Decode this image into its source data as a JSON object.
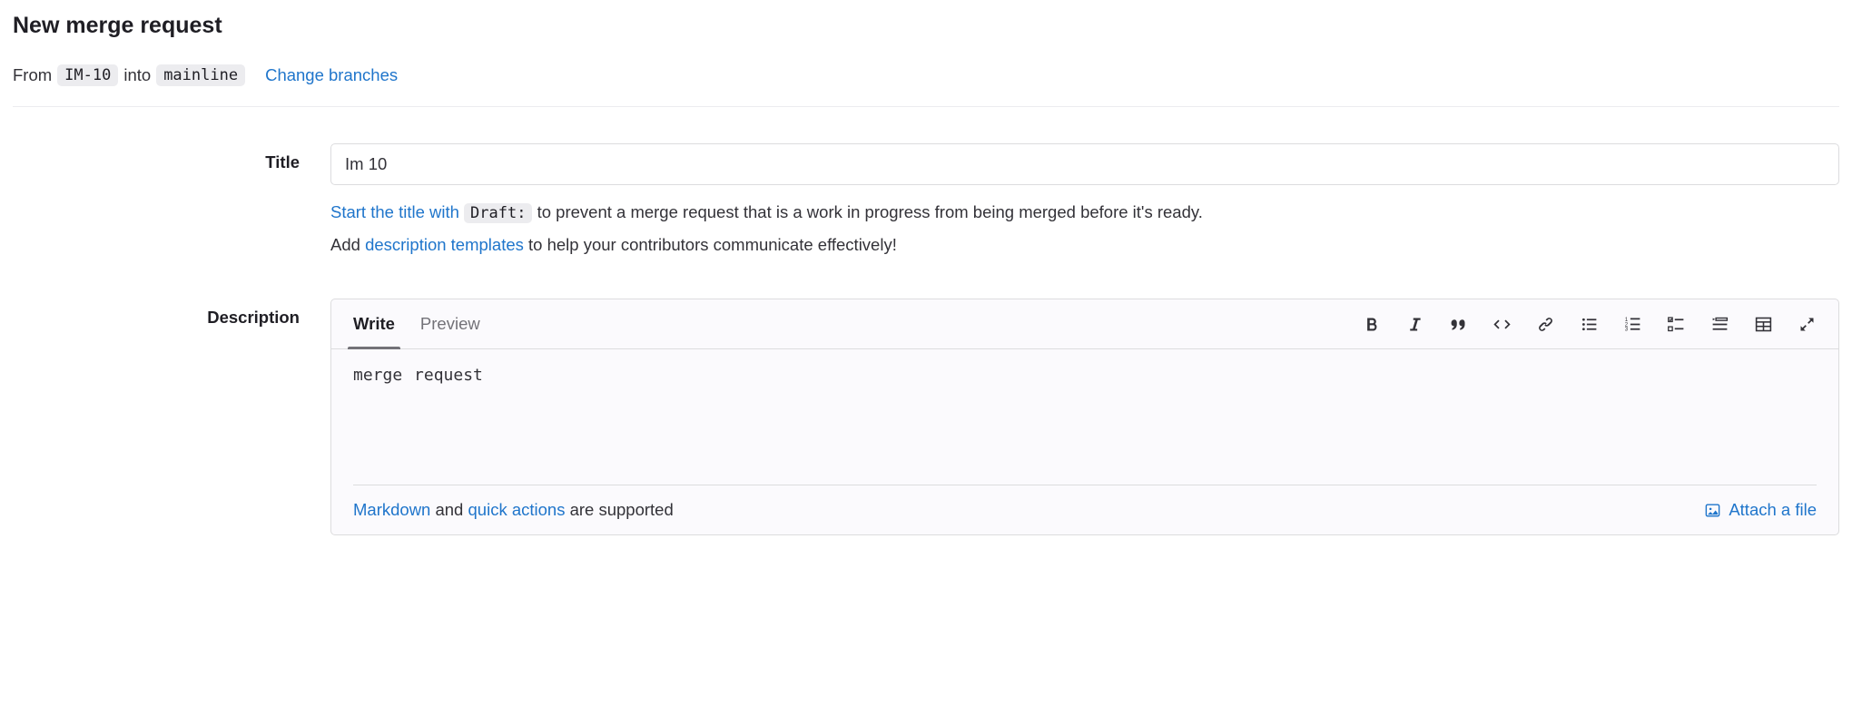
{
  "page_title": "New merge request",
  "branch": {
    "from_label": "From",
    "from_branch": "IM-10",
    "into_label": "into",
    "into_branch": "mainline",
    "change_link": "Change branches"
  },
  "title_section": {
    "label": "Title",
    "value": "Im 10",
    "draft_link_text": "Start the title with ",
    "draft_code": "Draft:",
    "draft_suffix": " to prevent a merge request that is a work in progress from being merged before it's ready.",
    "add_prefix": "Add ",
    "desc_templates_link": "description templates",
    "desc_templates_suffix": " to help your contributors communicate effectively!"
  },
  "description_section": {
    "label": "Description",
    "tabs": {
      "write": "Write",
      "preview": "Preview"
    },
    "body": "merge request",
    "footer": {
      "markdown_link": "Markdown",
      "and": " and ",
      "quick_actions_link": "quick actions",
      "supported": " are supported",
      "attach": "Attach a file"
    }
  }
}
